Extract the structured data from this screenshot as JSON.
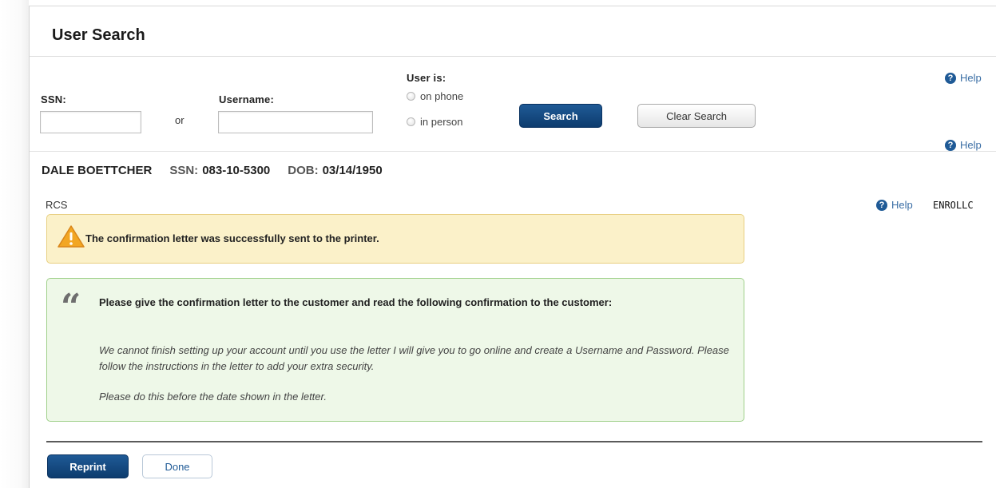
{
  "page": {
    "title": "User Search"
  },
  "search": {
    "ssn_label": "SSN:",
    "or_label": "or",
    "username_label": "Username:",
    "ssn_value": "",
    "username_value": "",
    "user_is_label": "User is:",
    "options": [
      {
        "label": "on phone",
        "selected": false
      },
      {
        "label": "in person",
        "selected": false
      }
    ],
    "search_button": "Search",
    "clear_button": "Clear Search",
    "help_label": "Help"
  },
  "user": {
    "name": "DALE BOETTCHER",
    "ssn_key": "SSN:",
    "ssn": "083-10-5300",
    "dob_key": "DOB:",
    "dob": "03/14/1950",
    "help_label": "Help"
  },
  "section": {
    "code": "RCS",
    "help_label": "Help",
    "screen_id": "ENROLLC"
  },
  "alert": {
    "message": "The confirmation letter was successfully sent to the printer."
  },
  "script": {
    "heading": "Please give the confirmation letter to the customer and read the following confirmation to the customer:",
    "body": "We cannot finish setting up your account until you use the letter I will give you to go online and create a Username and Password. Please follow the instructions in the letter to add your extra security.",
    "closing": "Please do this before the date shown in the letter."
  },
  "footer": {
    "reprint_button": "Reprint",
    "done_button": "Done"
  },
  "colors": {
    "primary_button": "#0d3c6e",
    "alert_bg": "#fbf1c9",
    "alert_border": "#e8cf82",
    "script_bg": "#eef8e8",
    "script_border": "#9fd08a",
    "help_link": "#3a6ea5"
  },
  "icons": [
    "help-icon",
    "warning-icon",
    "quote-icon",
    "radio-icon"
  ]
}
